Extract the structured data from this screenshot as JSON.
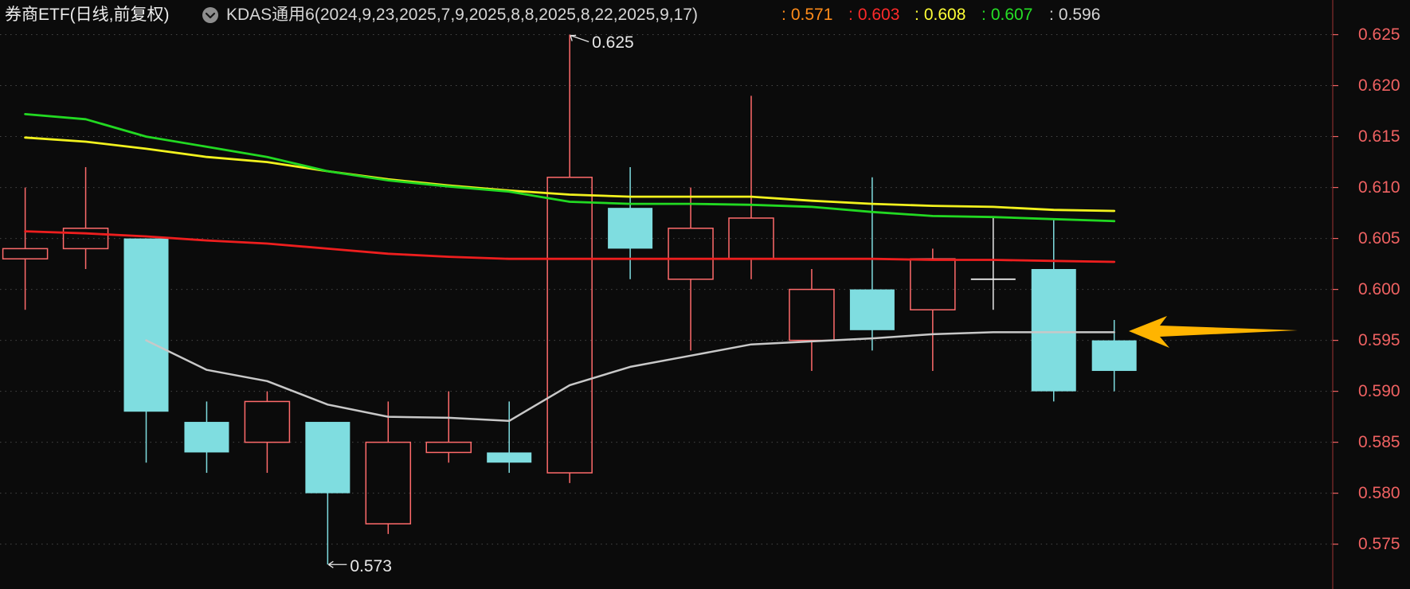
{
  "header": {
    "dropdown_icon": "chevron-down-circle-icon"
  },
  "chart_data": {
    "type": "candlestick",
    "title": "券商ETF(日线,前复权)",
    "indicator": {
      "label": "KDAS通用6(2024,9,23,2025,7,9,2025,8,8,2025,8,22,2025,9,17)",
      "readouts": [
        {
          "label": ":",
          "value": "0.571",
          "color": "#ff8c1a"
        },
        {
          "label": ":",
          "value": "0.603",
          "color": "#ff2a2a"
        },
        {
          "label": ":",
          "value": "0.608",
          "color": "#ffff36"
        },
        {
          "label": ":",
          "value": "0.607",
          "color": "#26e026"
        },
        {
          "label": ":",
          "value": "0.596",
          "color": "#d4d4d4"
        }
      ]
    },
    "candles": [
      {
        "open": 0.603,
        "high": 0.61,
        "low": 0.598,
        "close": 0.604
      },
      {
        "open": 0.604,
        "high": 0.612,
        "low": 0.602,
        "close": 0.606
      },
      {
        "open": 0.605,
        "high": 0.605,
        "low": 0.583,
        "close": 0.588
      },
      {
        "open": 0.587,
        "high": 0.589,
        "low": 0.582,
        "close": 0.584
      },
      {
        "open": 0.585,
        "high": 0.59,
        "low": 0.582,
        "close": 0.589
      },
      {
        "open": 0.587,
        "high": 0.587,
        "low": 0.573,
        "close": 0.58
      },
      {
        "open": 0.577,
        "high": 0.589,
        "low": 0.576,
        "close": 0.585
      },
      {
        "open": 0.584,
        "high": 0.59,
        "low": 0.583,
        "close": 0.585
      },
      {
        "open": 0.584,
        "high": 0.589,
        "low": 0.582,
        "close": 0.583
      },
      {
        "open": 0.582,
        "high": 0.625,
        "low": 0.581,
        "close": 0.611
      },
      {
        "open": 0.608,
        "high": 0.612,
        "low": 0.601,
        "close": 0.604
      },
      {
        "open": 0.601,
        "high": 0.61,
        "low": 0.594,
        "close": 0.606
      },
      {
        "open": 0.603,
        "high": 0.619,
        "low": 0.601,
        "close": 0.607
      },
      {
        "open": 0.595,
        "high": 0.602,
        "low": 0.592,
        "close": 0.6
      },
      {
        "open": 0.6,
        "high": 0.611,
        "low": 0.594,
        "close": 0.596
      },
      {
        "open": 0.598,
        "high": 0.604,
        "low": 0.592,
        "close": 0.603
      },
      {
        "open": 0.601,
        "high": 0.607,
        "low": 0.598,
        "close": 0.601
      },
      {
        "open": 0.602,
        "high": 0.607,
        "low": 0.589,
        "close": 0.59
      },
      {
        "open": 0.595,
        "high": 0.597,
        "low": 0.59,
        "close": 0.592
      }
    ],
    "series": [
      {
        "color": "#ee1e1e",
        "values": [
          0.6057,
          0.6055,
          0.6052,
          0.6048,
          0.6045,
          0.604,
          0.6035,
          0.6032,
          0.603,
          0.603,
          0.603,
          0.603,
          0.603,
          0.603,
          0.603,
          0.6029,
          0.6029,
          0.6028,
          0.6027
        ]
      },
      {
        "color": "#f2f21e",
        "values": [
          0.6149,
          0.6145,
          0.6138,
          0.613,
          0.6125,
          0.6116,
          0.6108,
          0.6102,
          0.6097,
          0.6093,
          0.6091,
          0.6091,
          0.6091,
          0.6087,
          0.6084,
          0.6082,
          0.6081,
          0.6078,
          0.6077
        ]
      },
      {
        "color": "#22d922",
        "values": [
          0.6172,
          0.6167,
          0.615,
          0.614,
          0.613,
          0.6116,
          0.6107,
          0.6101,
          0.6096,
          0.6086,
          0.6084,
          0.6084,
          0.6083,
          0.6081,
          0.6076,
          0.6072,
          0.6071,
          0.6069,
          0.6067
        ]
      },
      {
        "color": "#c8c8c8",
        "values": [
          null,
          null,
          0.595,
          0.5921,
          0.591,
          0.5887,
          0.5875,
          0.5874,
          0.5871,
          0.5906,
          0.5924,
          0.5935,
          0.5946,
          0.5949,
          0.5952,
          0.5956,
          0.5958,
          0.5958,
          0.5958
        ]
      }
    ],
    "y_ticks": [
      "0.625",
      "0.620",
      "0.615",
      "0.610",
      "0.605",
      "0.600",
      "0.595",
      "0.590",
      "0.585",
      "0.580",
      "0.575"
    ],
    "ylim": [
      0.5706,
      0.6284
    ],
    "annotations": [
      {
        "text": "0.625",
        "value": 0.625,
        "candle": 9
      },
      {
        "text": "0.573",
        "value": 0.573,
        "candle": 5
      }
    ],
    "axis_position": "right",
    "legend_placement": "top-left",
    "grid": true,
    "colors": {
      "background": "#0b0b0b",
      "title": "#ececec",
      "indicator": "#d6d6d6",
      "up": "#ff6b6b",
      "down": "#7fdde0",
      "flat": "#e8e8e8",
      "axis_label": "#f06262",
      "axis_line": "#6e2626",
      "grid": "#474747",
      "annotation": "#e8e8e8",
      "highlight_arrow": "#ffb400",
      "icon": "#8e8e8e"
    }
  }
}
